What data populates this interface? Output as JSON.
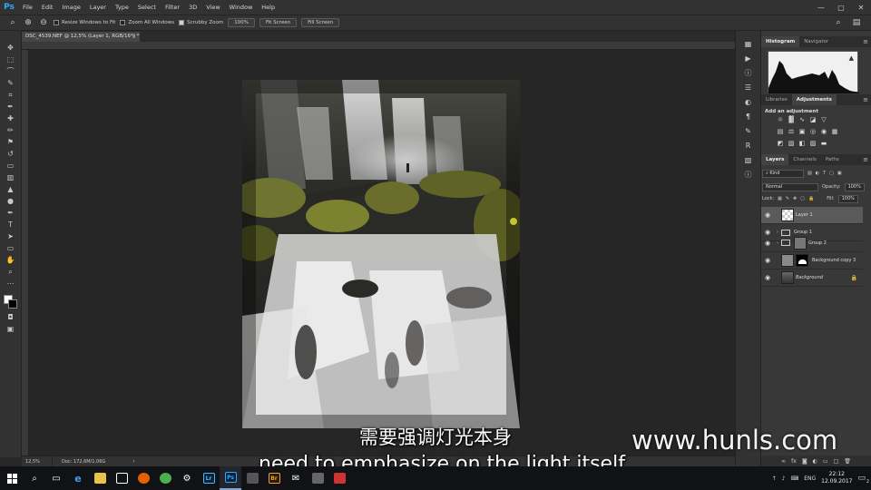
{
  "app": {
    "menu": [
      "File",
      "Edit",
      "Image",
      "Layer",
      "Type",
      "Select",
      "Filter",
      "3D",
      "View",
      "Window",
      "Help"
    ],
    "window_controls": [
      "—",
      "▢",
      "✕"
    ]
  },
  "options": {
    "resize_windows": "Resize Windows to Fit",
    "zoom_all": "Zoom All Windows",
    "scrubby_zoom": "Scrubby Zoom",
    "btn_100": "100%",
    "btn_fit": "Fit Screen",
    "btn_fill": "Fill Screen"
  },
  "document": {
    "tab_title": "DSC_4539.NEF @ 12,5% (Layer 1, RGB/16*) *",
    "zoom": "12,5%",
    "doc_info": "Doc: 172,6M/1,06G"
  },
  "panels": {
    "histogram_tabs": [
      "Histogram",
      "Navigator"
    ],
    "adjust_tabs": [
      "Libraries",
      "Adjustments"
    ],
    "add_adjustment": "Add an adjustment",
    "layers_tabs": [
      "Layers",
      "Channels",
      "Paths"
    ],
    "kind": "Kind",
    "blend_mode": "Normal",
    "opacity_label": "Opacity:",
    "opacity": "100%",
    "lock_label": "Lock:",
    "fill_label": "Fill:",
    "fill": "100%"
  },
  "layers": [
    {
      "name": "Layer 1",
      "selected": true
    },
    {
      "name": "Group 1"
    },
    {
      "name": "Group 2"
    },
    {
      "name": "Background copy 3"
    },
    {
      "name": "Background"
    }
  ],
  "subtitles": {
    "chinese": "需要强调灯光本身",
    "english": "need to emphasize on the light itself"
  },
  "watermark": "www.hunls.com",
  "taskbar": {
    "lang": "ENG",
    "time": "22:12",
    "date": "12.09.2017",
    "notifications": "2",
    "apps": [
      "Lr",
      "Ps",
      "Br"
    ]
  }
}
